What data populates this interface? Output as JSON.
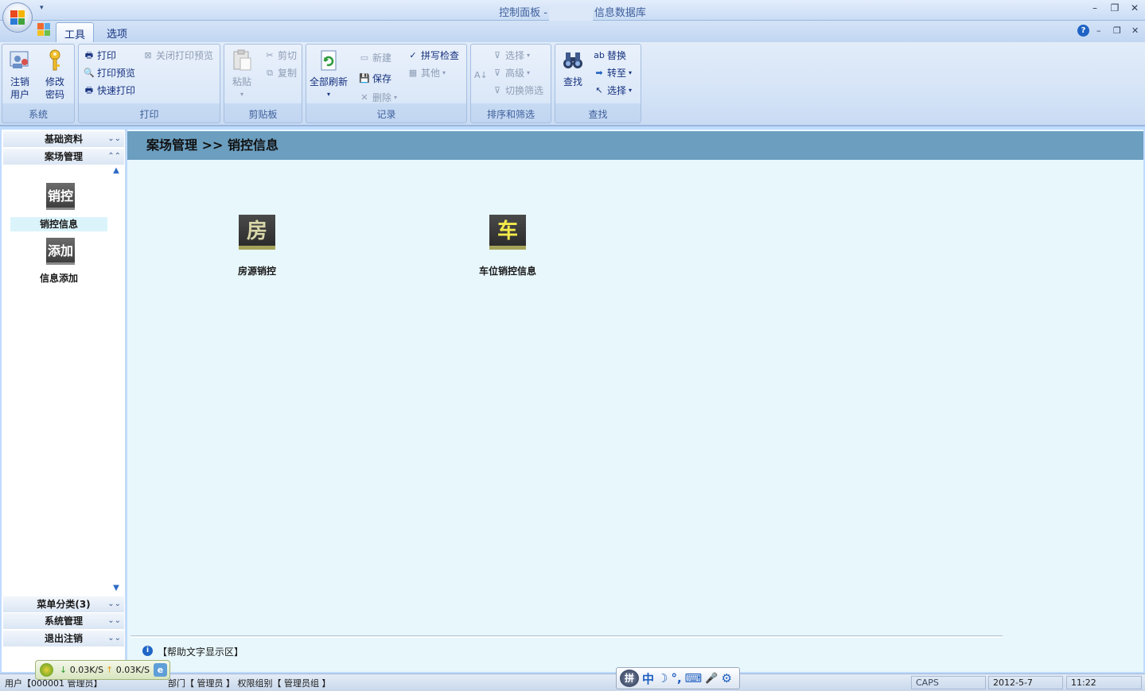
{
  "window": {
    "title_left": "控制面板 -",
    "title_right": "信息数据库"
  },
  "tabs": [
    {
      "label": "工具"
    },
    {
      "label": "选项"
    }
  ],
  "ribbon": {
    "system": {
      "label": "系统",
      "logout_line1": "注销",
      "logout_line2": "用户",
      "password_line1": "修改",
      "password_line2": "密码"
    },
    "print": {
      "label": "打印",
      "print": "打印",
      "preview": "打印预览",
      "quick": "快速打印",
      "close_preview": "关闭打印预览"
    },
    "clipboard": {
      "label": "剪贴板",
      "paste": "粘贴",
      "cut": "剪切",
      "copy": "复制"
    },
    "records": {
      "label": "记录",
      "refresh_all": "全部刷新",
      "new": "新建",
      "save": "保存",
      "delete": "删除",
      "spell": "拼写检查",
      "other": "其他"
    },
    "sort": {
      "label": "排序和筛选",
      "select": "选择",
      "advanced": "高级",
      "toggle": "切换筛选"
    },
    "find": {
      "label": "查找",
      "find": "查找",
      "replace": "替换",
      "goto": "转至",
      "select": "选择"
    }
  },
  "nav": {
    "sections_top": [
      "基础资料",
      "案场管理"
    ],
    "items": [
      {
        "icon": "销控",
        "label": "销控信息"
      },
      {
        "icon": "添加",
        "label": "信息添加"
      }
    ],
    "sections_bottom": [
      "菜单分类(3)",
      "系统管理",
      "退出注销"
    ]
  },
  "main": {
    "breadcrumb": "案场管理 >> 销控信息",
    "tiles": [
      {
        "icon": "房",
        "label": "房源销控",
        "icon_color": "#d8d6a8"
      },
      {
        "icon": "车",
        "label": "车位销控信息",
        "icon_color": "#f3e94a"
      }
    ],
    "help": "【帮助文字显示区】"
  },
  "netspeed": {
    "down": "0.03K/S",
    "up": "0.03K/S"
  },
  "ime": {
    "items": [
      "中",
      "☽",
      "°,",
      "⌨",
      "🎤",
      "⚙"
    ]
  },
  "statusbar": {
    "user": "用户【000001 管理员】",
    "dept": "部门【 管理员 】 权限组别【 管理员组 】",
    "caps": "CAPS",
    "date": "2012-5-7",
    "time": "11:22"
  }
}
